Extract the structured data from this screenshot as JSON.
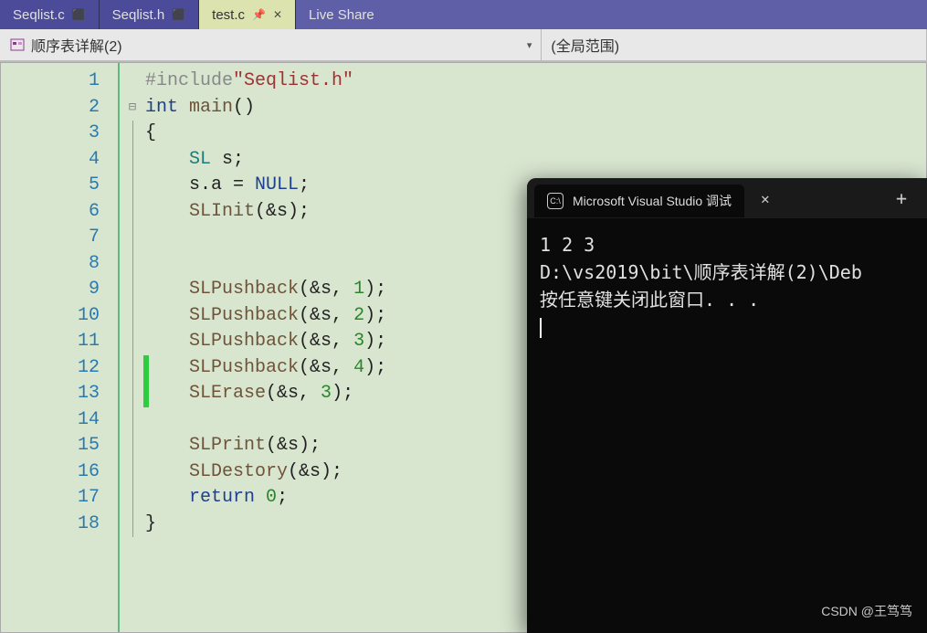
{
  "tabs": [
    {
      "label": "Seqlist.c",
      "pinned": true
    },
    {
      "label": "Seqlist.h",
      "pinned": true
    },
    {
      "label": "test.c",
      "pinned": true,
      "active": true
    },
    {
      "label": "Live Share"
    }
  ],
  "nav": {
    "scope_left": "顺序表详解(2)",
    "scope_right": "(全局范围)"
  },
  "code": {
    "lines": [
      {
        "num": 1,
        "tokens": [
          [
            "preproc",
            "#include"
          ],
          [
            "str",
            "\"Seqlist.h\""
          ]
        ]
      },
      {
        "num": 2,
        "fold": "minus",
        "tokens": [
          [
            "keyword",
            "int"
          ],
          [
            "default",
            " "
          ],
          [
            "func",
            "main"
          ],
          [
            "default",
            "()"
          ]
        ]
      },
      {
        "num": 3,
        "tokens": [
          [
            "default",
            "{"
          ]
        ]
      },
      {
        "num": 4,
        "tokens": [
          [
            "default",
            "    "
          ],
          [
            "type",
            "SL"
          ],
          [
            "default",
            " s;"
          ]
        ]
      },
      {
        "num": 5,
        "tokens": [
          [
            "default",
            "    s.a = "
          ],
          [
            "keyword",
            "NULL"
          ],
          [
            "default",
            ";"
          ]
        ]
      },
      {
        "num": 6,
        "tokens": [
          [
            "default",
            "    "
          ],
          [
            "func",
            "SLInit"
          ],
          [
            "default",
            "(&s);"
          ]
        ]
      },
      {
        "num": 7,
        "tokens": [
          [
            "default",
            ""
          ]
        ]
      },
      {
        "num": 8,
        "tokens": [
          [
            "default",
            ""
          ]
        ]
      },
      {
        "num": 9,
        "tokens": [
          [
            "default",
            "    "
          ],
          [
            "func",
            "SLPushback"
          ],
          [
            "default",
            "(&s, "
          ],
          [
            "num",
            "1"
          ],
          [
            "default",
            ");"
          ]
        ]
      },
      {
        "num": 10,
        "tokens": [
          [
            "default",
            "    "
          ],
          [
            "func",
            "SLPushback"
          ],
          [
            "default",
            "(&s, "
          ],
          [
            "num",
            "2"
          ],
          [
            "default",
            ");"
          ]
        ]
      },
      {
        "num": 11,
        "tokens": [
          [
            "default",
            "    "
          ],
          [
            "func",
            "SLPushback"
          ],
          [
            "default",
            "(&s, "
          ],
          [
            "num",
            "3"
          ],
          [
            "default",
            ");"
          ]
        ]
      },
      {
        "num": 12,
        "changed": true,
        "tokens": [
          [
            "default",
            "    "
          ],
          [
            "func",
            "SLPushback"
          ],
          [
            "default",
            "(&s, "
          ],
          [
            "num",
            "4"
          ],
          [
            "default",
            ");"
          ]
        ]
      },
      {
        "num": 13,
        "changed": true,
        "tokens": [
          [
            "default",
            "    "
          ],
          [
            "func",
            "SLErase"
          ],
          [
            "default",
            "(&s, "
          ],
          [
            "num",
            "3"
          ],
          [
            "default",
            ");"
          ]
        ]
      },
      {
        "num": 14,
        "tokens": [
          [
            "default",
            ""
          ]
        ]
      },
      {
        "num": 15,
        "tokens": [
          [
            "default",
            "    "
          ],
          [
            "func",
            "SLPrint"
          ],
          [
            "default",
            "(&s);"
          ]
        ]
      },
      {
        "num": 16,
        "tokens": [
          [
            "default",
            "    "
          ],
          [
            "func",
            "SLDestory"
          ],
          [
            "default",
            "(&s);"
          ]
        ]
      },
      {
        "num": 17,
        "tokens": [
          [
            "default",
            "    "
          ],
          [
            "keyword",
            "return"
          ],
          [
            "default",
            " "
          ],
          [
            "num",
            "0"
          ],
          [
            "default",
            ";"
          ]
        ]
      },
      {
        "num": 18,
        "tokens": [
          [
            "default",
            "}"
          ]
        ]
      }
    ]
  },
  "terminal": {
    "tab_title": "Microsoft Visual Studio 调试",
    "output": [
      "1 2 3",
      "D:\\vs2019\\bit\\顺序表详解(2)\\Deb",
      "按任意键关闭此窗口. . ."
    ]
  },
  "watermark": "CSDN @王笃笃"
}
